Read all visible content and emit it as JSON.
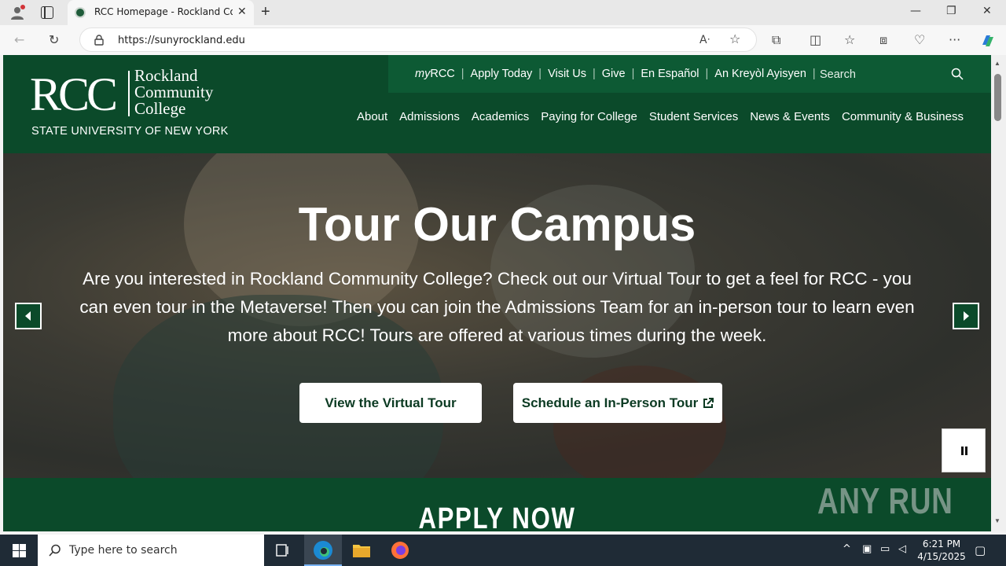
{
  "browser": {
    "tab_title": "RCC Homepage - Rockland Com",
    "url": "https://sunyrockland.edu"
  },
  "site": {
    "logo_rcc": "RCC",
    "logo_name_1": "Rockland",
    "logo_name_2": "Community",
    "logo_name_3": "College",
    "logo_suny": "STATE UNIVERSITY OF NEW YORK",
    "utility": {
      "myrcc_prefix": "my",
      "myrcc_suffix": "RCC",
      "apply": "Apply Today",
      "visit": "Visit Us",
      "give": "Give",
      "espanol": "En Español",
      "kreyol": "An Kreyòl Ayisyen",
      "search_placeholder": "Search"
    },
    "nav": [
      "About",
      "Admissions",
      "Academics",
      "Paying for College",
      "Student Services",
      "News & Events",
      "Community & Business"
    ],
    "hero": {
      "title": "Tour Our Campus",
      "text": "Are you interested in Rockland Community College? Check out our Virtual Tour to get a feel for RCC - you can even tour in the Metaverse! Then you can join the Admissions Team for an in-person tour to learn even more about RCC! Tours are offered at various times during the week.",
      "btn_virtual": "View the Virtual Tour",
      "btn_inperson": "Schedule an In-Person Tour"
    },
    "apply_title": "APPLY NOW",
    "watermark": "ANY RUN"
  },
  "taskbar": {
    "search_placeholder": "Type here to search",
    "time": "6:21 PM",
    "date": "4/15/2025"
  },
  "colors": {
    "brand_green": "#0b4a2a",
    "utility_green": "#0d5a34"
  }
}
